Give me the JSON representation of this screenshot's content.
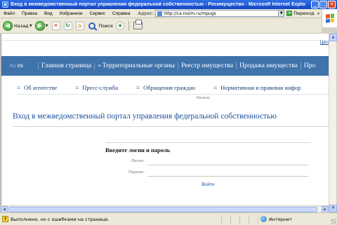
{
  "window": {
    "title": "Вход в межведомственный портал управления федеральной собственностью - Росимущество - Microsoft Internet Explorer",
    "minimize": "_",
    "maximize": "□",
    "close": "✕"
  },
  "menubar": {
    "items": [
      "Файл",
      "Правка",
      "Вид",
      "Избранное",
      "Сервис",
      "Справка"
    ],
    "address_label": "Адрес:",
    "address_value": "http://ca.rosim.ru/mpugs",
    "go_label": "Переход",
    "links_label": "»"
  },
  "toolbar": {
    "back_label": "Назад",
    "search_label": "Поиск"
  },
  "page": {
    "top_link": "Цен",
    "lang_ru": "RU",
    "lang_en": "EN",
    "nav": [
      "Главная страница",
      "Территориальные органы",
      "Реестр имущества",
      "Продажа имущества",
      "Про"
    ],
    "subnav": [
      "Об агентстве",
      "Пресс-служба",
      "Обращения граждан",
      "Нормативная и правовая инфор"
    ],
    "breadcrumb": "Начало",
    "title": "Вход в межведомственный портал управления федеральной собственностью",
    "login": {
      "heading": "Введите логин и пароль",
      "login_label": "Логин:",
      "password_label": "Пароль:",
      "submit": "Войти"
    }
  },
  "statusbar": {
    "text": "Выполнено, но с ошибками на странице.",
    "zone": "Интернет"
  }
}
